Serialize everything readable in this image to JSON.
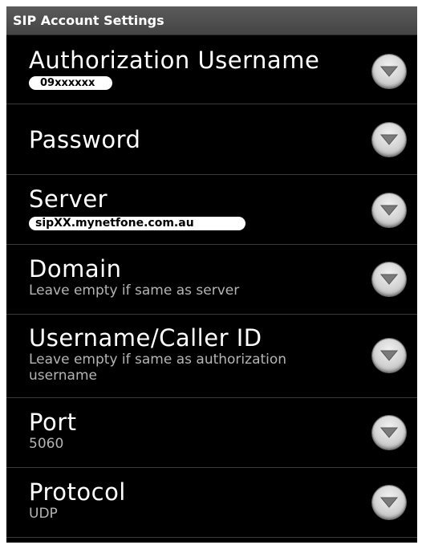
{
  "header": {
    "title": "SIP Account Settings"
  },
  "preferences": [
    {
      "title": "Authorization Username",
      "value": "09xxxxxx",
      "icon": "dropdown-arrow-icon"
    },
    {
      "title": "Password",
      "icon": "dropdown-arrow-icon"
    },
    {
      "title": "Server",
      "value": "sipXX.mynetfone.com.au",
      "icon": "dropdown-arrow-icon"
    },
    {
      "title": "Domain",
      "summary": "Leave empty if same as server",
      "icon": "dropdown-arrow-icon"
    },
    {
      "title": "Username/Caller ID",
      "summary": "Leave empty if same as authorization username",
      "icon": "dropdown-arrow-icon"
    },
    {
      "title": "Port",
      "summary": "5060",
      "icon": "dropdown-arrow-icon"
    },
    {
      "title": "Protocol",
      "summary": "UDP",
      "icon": "dropdown-arrow-icon"
    }
  ],
  "colors": {
    "background": "#000000",
    "title_bar": "#4f4f4f",
    "primary_text": "#ffffff",
    "secondary_text": "#b4b4b4",
    "divider": "#3a3a3a"
  }
}
